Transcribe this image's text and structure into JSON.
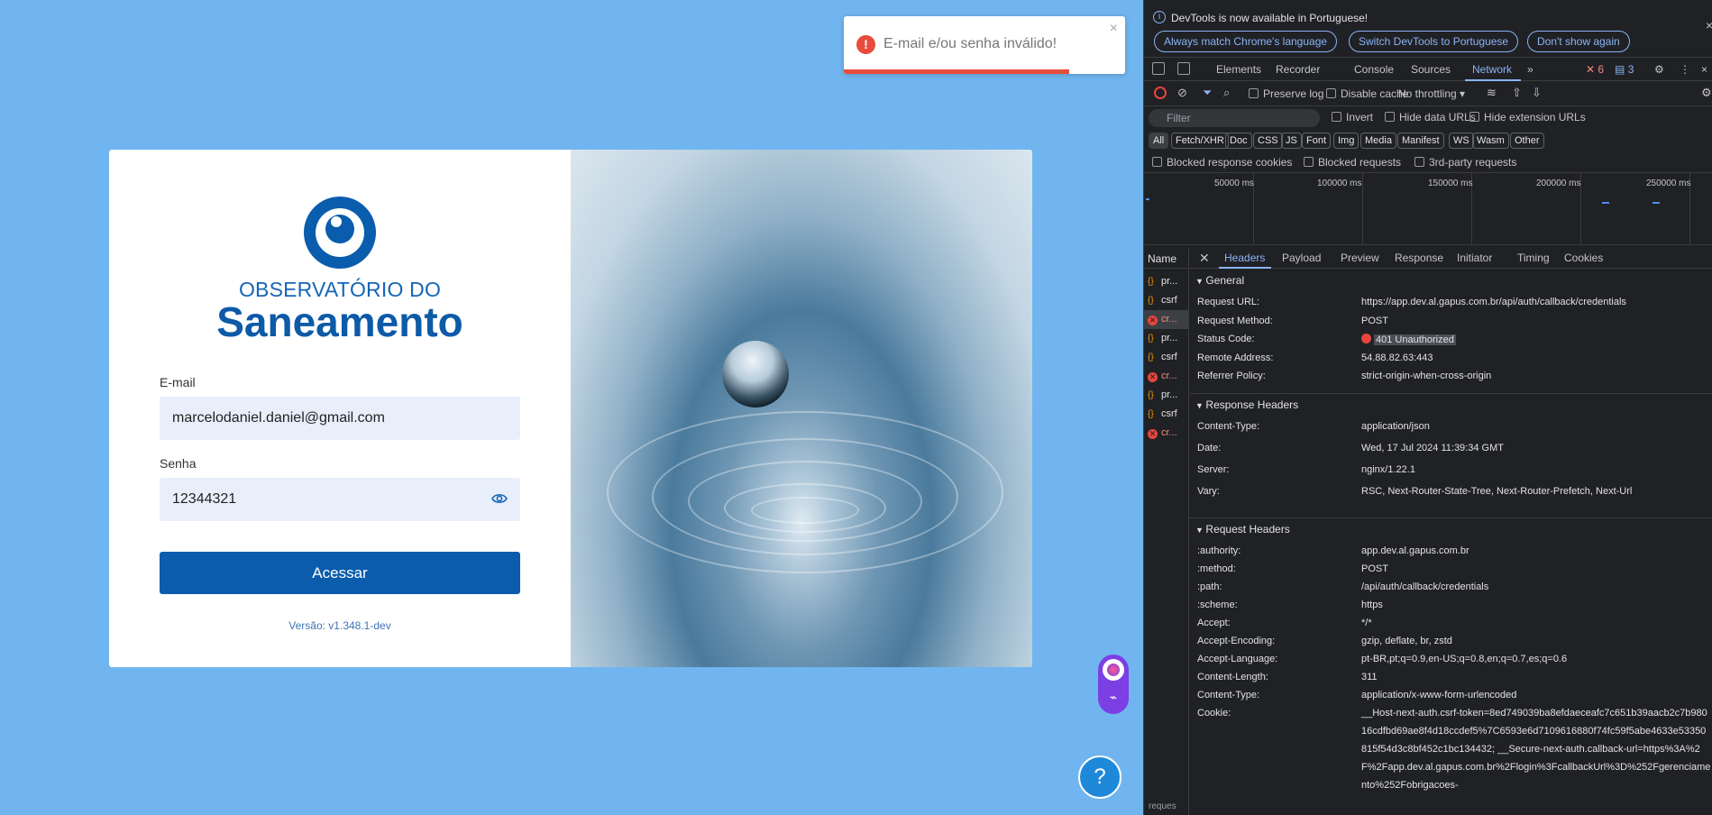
{
  "toast": {
    "message": "E-mail e/ou senha inválido!",
    "close_label": "×",
    "progress": 0.8
  },
  "brand": {
    "line1": "OBSERVATÓRIO DO",
    "line2": "Saneamento"
  },
  "form": {
    "email_label": "E-mail",
    "email_value": "marcelodaniel.daniel@gmail.com",
    "password_label": "Senha",
    "password_value": "12344321",
    "submit_label": "Acessar",
    "version": "Versão: v1.348.1-dev"
  },
  "help": {
    "label": "?"
  },
  "devtools": {
    "info_text": "DevTools is now available in Portuguese!",
    "info_buttons": [
      "Always match Chrome's language",
      "Switch DevTools to Portuguese",
      "Don't show again"
    ],
    "tabs": [
      "Elements",
      "Recorder",
      "Console",
      "Sources",
      "Network"
    ],
    "active_tab": "Network",
    "error_count": "6",
    "message_count": "3",
    "toolbar": {
      "preserve_log": "Preserve log",
      "disable_cache": "Disable cache",
      "throttling": "No throttling"
    },
    "filter": {
      "placeholder": "Filter",
      "invert": "Invert",
      "hide_data_urls": "Hide data URLs",
      "hide_extension_urls": "Hide extension URLs"
    },
    "type_filters": [
      "All",
      "Fetch/XHR",
      "Doc",
      "CSS",
      "JS",
      "Font",
      "Img",
      "Media",
      "Manifest",
      "WS",
      "Wasm",
      "Other"
    ],
    "blocked": {
      "response_cookies": "Blocked response cookies",
      "requests": "Blocked requests",
      "third_party": "3rd-party requests"
    },
    "timeline_labels": [
      "50000 ms",
      "100000 ms",
      "150000 ms",
      "200000 ms",
      "250000 ms"
    ],
    "list_header": "Name",
    "requests": [
      {
        "name": "pr...",
        "kind": "xhr"
      },
      {
        "name": "csrf",
        "kind": "xhr"
      },
      {
        "name": "cr...",
        "kind": "err"
      },
      {
        "name": "pr...",
        "kind": "xhr"
      },
      {
        "name": "csrf",
        "kind": "xhr"
      },
      {
        "name": "cr...",
        "kind": "err"
      },
      {
        "name": "pr...",
        "kind": "xhr"
      },
      {
        "name": "csrf",
        "kind": "xhr"
      },
      {
        "name": "cr...",
        "kind": "err"
      }
    ],
    "bottom_status": "reques",
    "detail_tabs": [
      "Headers",
      "Payload",
      "Preview",
      "Response",
      "Initiator",
      "Timing",
      "Cookies"
    ],
    "general": {
      "title": "General",
      "rows": [
        [
          "Request URL:",
          "https://app.dev.al.gapus.com.br/api/auth/callback/credentials"
        ],
        [
          "Request Method:",
          "POST"
        ],
        [
          "Status Code:",
          "401 Unauthorized"
        ],
        [
          "Remote Address:",
          "54.88.82.63:443"
        ],
        [
          "Referrer Policy:",
          "strict-origin-when-cross-origin"
        ]
      ]
    },
    "response_headers": {
      "title": "Response Headers",
      "rows": [
        [
          "Content-Type:",
          "application/json"
        ],
        [
          "Date:",
          "Wed, 17 Jul 2024 11:39:34 GMT"
        ],
        [
          "Server:",
          "nginx/1.22.1"
        ],
        [
          "Vary:",
          "RSC, Next-Router-State-Tree, Next-Router-Prefetch, Next-Url"
        ]
      ]
    },
    "request_headers": {
      "title": "Request Headers",
      "rows": [
        [
          ":authority:",
          "app.dev.al.gapus.com.br"
        ],
        [
          ":method:",
          "POST"
        ],
        [
          ":path:",
          "/api/auth/callback/credentials"
        ],
        [
          ":scheme:",
          "https"
        ],
        [
          "Accept:",
          "*/*"
        ],
        [
          "Accept-Encoding:",
          "gzip, deflate, br, zstd"
        ],
        [
          "Accept-Language:",
          "pt-BR,pt;q=0.9,en-US;q=0.8,en;q=0.7,es;q=0.6"
        ],
        [
          "Content-Length:",
          "311"
        ],
        [
          "Content-Type:",
          "application/x-www-form-urlencoded"
        ],
        [
          "Cookie:",
          "__Host-next-auth.csrf-token=8ed749039ba8efdaeceafc7c651b39aacb2c7b98016cdfbd69ae8f4d18ccdef5%7C6593e6d7109616880f74fc59f5abe4633e53350815f54d3c8bf452c1bc134432; __Secure-next-auth.callback-url=https%3A%2F%2Fapp.dev.al.gapus.com.br%2Flogin%3FcallbackUrl%3D%252Fgerenciamento%252Fobrigacoes-"
        ]
      ]
    }
  }
}
